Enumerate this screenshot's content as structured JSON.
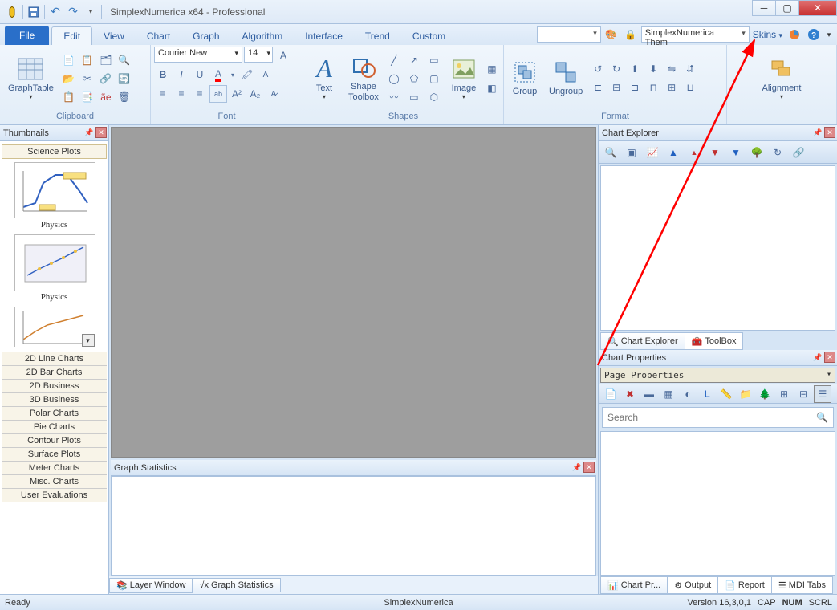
{
  "title": "SimplexNumerica x64 - Professional",
  "menus": {
    "file": "File",
    "edit": "Edit",
    "view": "View",
    "chart": "Chart",
    "graph": "Graph",
    "algorithm": "Algorithm",
    "interface": "Interface",
    "trend": "Trend",
    "custom": "Custom"
  },
  "theme_combo": "SimplexNumerica Them",
  "skins": "Skins",
  "ribbon": {
    "graphtable": "GraphTable",
    "clipboard": "Clipboard",
    "font_name": "Courier New",
    "font_size": "14",
    "font": "Font",
    "text": "Text",
    "shape_toolbox": "Shape\nToolbox",
    "shapes": "Shapes",
    "image": "Image",
    "group": "Group",
    "ungroup": "Ungroup",
    "format": "Format",
    "alignment": "Alignment"
  },
  "thumbnails": {
    "title": "Thumbnails",
    "active_cat": "Science Plots",
    "items": [
      {
        "label": "Physics"
      },
      {
        "label": "Physics"
      }
    ],
    "cats": [
      "2D Line Charts",
      "2D Bar Charts",
      "2D Business",
      "3D Business",
      "Polar Charts",
      "Pie Charts",
      "Contour Plots",
      "Surface Plots",
      "Meter Charts",
      "Misc. Charts",
      "User Evaluations"
    ]
  },
  "gstat": {
    "title": "Graph Statistics"
  },
  "bottom_tabs": {
    "layer": "Layer Window",
    "gstat": "Graph Statistics"
  },
  "explorer": {
    "title": "Chart Explorer",
    "tabs": {
      "ce": "Chart Explorer",
      "tb": "ToolBox"
    }
  },
  "props": {
    "title": "Chart Properties",
    "dropdown": "Page Properties",
    "search_ph": "Search",
    "tabs": {
      "cp": "Chart Pr...",
      "out": "Output",
      "rep": "Report",
      "mdi": "MDI Tabs"
    }
  },
  "status": {
    "ready": "Ready",
    "app": "SimplexNumerica",
    "ver": "Version 16,3,0,1",
    "cap": "CAP",
    "num": "NUM",
    "scrl": "SCRL"
  }
}
